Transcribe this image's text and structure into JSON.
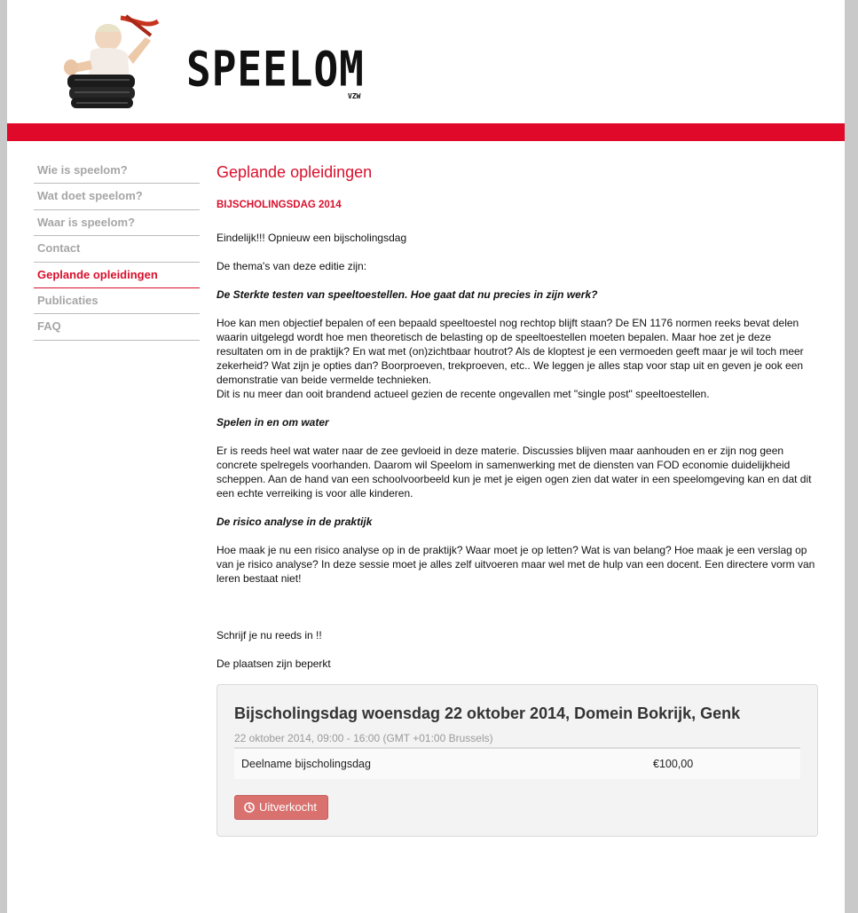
{
  "header": {
    "logo_text": "SPEELOM",
    "logo_sub": "VZW"
  },
  "sidebar": {
    "items": [
      {
        "label": "Wie is speelom?"
      },
      {
        "label": "Wat doet speelom?"
      },
      {
        "label": "Waar is speelom?"
      },
      {
        "label": "Contact"
      },
      {
        "label": "Geplande opleidingen"
      },
      {
        "label": "Publicaties"
      },
      {
        "label": "FAQ"
      }
    ],
    "active_index": 4
  },
  "content": {
    "title": "Geplande opleidingen",
    "subtitle": "BIJSCHOLINGSDAG 2014",
    "intro": "Eindelijk!!! Opnieuw een bijscholingsdag",
    "themes_intro": "De thema's van deze editie zijn:",
    "theme1_title": "De Sterkte testen van speeltoestellen. Hoe gaat dat nu precies in zijn werk?",
    "theme1_p1": "Hoe kan men objectief bepalen of een bepaald speeltoestel nog rechtop blijft staan? De EN 1176 normen reeks bevat delen waarin uitgelegd wordt hoe men theoretisch de belasting op de speeltoestellen moeten bepalen. Maar hoe zet je deze resultaten om in de praktijk? En wat met (on)zichtbaar houtrot? Als de kloptest je een vermoeden geeft maar je wil toch meer zekerheid? Wat zijn je opties dan? Boorproeven, trekproeven, etc.. We leggen je alles stap voor stap uit en geven je ook een demonstratie van beide vermelde technieken.",
    "theme1_p2": "Dit is nu meer dan ooit brandend actueel gezien de recente ongevallen met \"single post\" speeltoestellen.",
    "theme2_title": "Spelen in en om water",
    "theme2_p": "Er is reeds heel wat water naar de zee gevloeid in deze materie. Discussies blijven maar aanhouden en er zijn nog geen concrete spelregels voorhanden. Daarom wil Speelom in samenwerking met de diensten van FOD economie duidelijkheid scheppen. Aan de hand van een schoolvoorbeeld kun je met je eigen ogen zien dat water in een speelomgeving kan en dat dit een echte verreiking is voor alle kinderen.",
    "theme3_title": "De risico analyse in de praktijk",
    "theme3_p": "Hoe maak je nu een risico analyse op in de praktijk? Waar moet je op letten? Wat is van belang? Hoe maak je een verslag op van je risico analyse? In deze sessie moet je alles zelf uitvoeren maar wel met de hulp van een docent. Een directere vorm van leren bestaat niet!",
    "signup": "Schrijf je nu reeds in !!",
    "limited": "De plaatsen zijn beperkt"
  },
  "event": {
    "title": "Bijscholingsdag woensdag 22 oktober 2014, Domein Bokrijk, Genk",
    "datetime": "22 oktober 2014, 09:00 - 16:00 (GMT +01:00 Brussels)",
    "ticket_name": "Deelname bijscholingsdag",
    "ticket_price": "€100,00",
    "button_label": "Uitverkocht",
    "button_icon": "clock-icon"
  },
  "colors": {
    "brand_red": "#e0092a",
    "text_red": "#d8102c",
    "button": "#d9716f"
  }
}
